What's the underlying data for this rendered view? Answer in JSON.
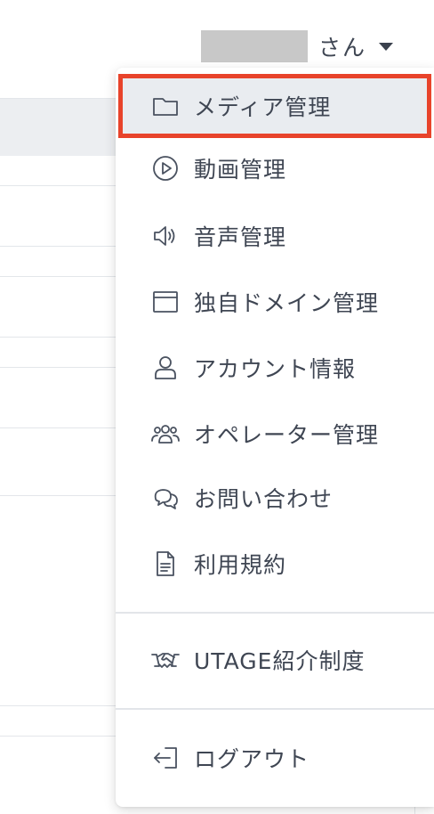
{
  "user": {
    "name_hidden": "",
    "suffix": "さん"
  },
  "menu": {
    "items": [
      {
        "label": "メディア管理",
        "icon": "folder-icon",
        "active": true
      },
      {
        "label": "動画管理",
        "icon": "play-circle-icon"
      },
      {
        "label": "音声管理",
        "icon": "speaker-icon"
      },
      {
        "label": "独自ドメイン管理",
        "icon": "browser-window-icon"
      },
      {
        "label": "アカウント情報",
        "icon": "user-icon"
      },
      {
        "label": "オペレーター管理",
        "icon": "users-group-icon"
      },
      {
        "label": "お問い合わせ",
        "icon": "chat-bubbles-icon"
      },
      {
        "label": "利用規約",
        "icon": "document-icon"
      }
    ],
    "referral": {
      "label": "UTAGE紹介制度",
      "icon": "handshake-icon"
    },
    "logout": {
      "label": "ログアウト",
      "icon": "logout-icon"
    }
  },
  "colors": {
    "highlight_border": "#e8432b",
    "active_bg": "#e9ecf0",
    "text": "#3f4653"
  }
}
